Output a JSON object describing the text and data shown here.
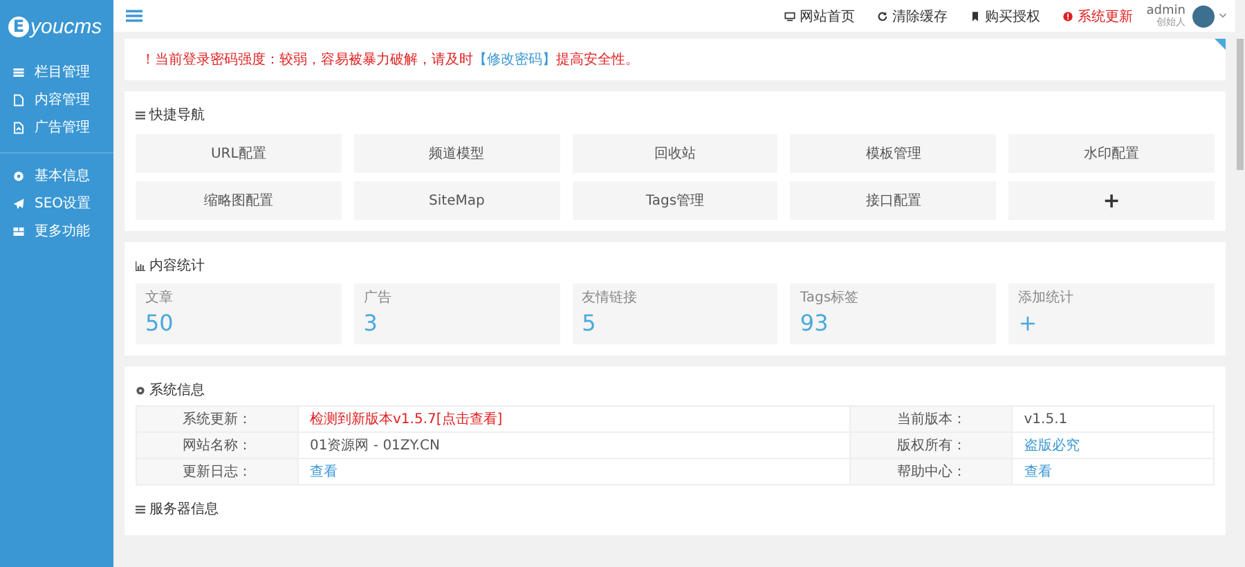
{
  "sidebar": {
    "logo_letter": "E",
    "logo_text": "youcms",
    "groups": [
      [
        {
          "label": "栏目管理"
        },
        {
          "label": "内容管理"
        },
        {
          "label": "广告管理"
        }
      ],
      [
        {
          "label": "基本信息"
        },
        {
          "label": "SEO设置"
        },
        {
          "label": "更多功能"
        }
      ]
    ]
  },
  "topbar": {
    "links": [
      {
        "label": "网站首页",
        "kind": "normal"
      },
      {
        "label": "清除缓存",
        "kind": "normal"
      },
      {
        "label": "购买授权",
        "kind": "normal"
      },
      {
        "label": "系统更新",
        "kind": "alert"
      }
    ],
    "user": {
      "name": "admin",
      "role": "创始人"
    }
  },
  "alert": {
    "before": "！当前登录密码强度：较弱，容易被暴力破解，请及时",
    "link": "【修改密码】",
    "after": "提高安全性。"
  },
  "quick_nav": {
    "title": "快捷导航",
    "items": [
      "URL配置",
      "频道模型",
      "回收站",
      "模板管理",
      "水印配置",
      "缩略图配置",
      "SiteMap",
      "Tags管理",
      "接口配置",
      "+"
    ]
  },
  "stats": {
    "title": "内容统计",
    "items": [
      {
        "label": "文章",
        "value": "50"
      },
      {
        "label": "广告",
        "value": "3"
      },
      {
        "label": "友情链接",
        "value": "5"
      },
      {
        "label": "Tags标签",
        "value": "93"
      },
      {
        "label": "添加统计",
        "value": "+"
      }
    ]
  },
  "system_info": {
    "title": "系统信息",
    "rows": [
      [
        {
          "text": "系统更新：",
          "kind": "label"
        },
        {
          "text": "检测到新版本v1.5.7[点击查看]",
          "kind": "alert"
        },
        {
          "text": "当前版本：",
          "kind": "label"
        },
        {
          "text": "v1.5.1",
          "kind": "value"
        }
      ],
      [
        {
          "text": "网站名称：",
          "kind": "label"
        },
        {
          "text": "01资源网 - 01ZY.CN",
          "kind": "value"
        },
        {
          "text": "版权所有：",
          "kind": "label"
        },
        {
          "text": "盗版必究",
          "kind": "link"
        }
      ],
      [
        {
          "text": "更新日志：",
          "kind": "label"
        },
        {
          "text": "查看",
          "kind": "link"
        },
        {
          "text": "帮助中心：",
          "kind": "label"
        },
        {
          "text": "查看",
          "kind": "link"
        }
      ]
    ]
  },
  "server_info": {
    "title": "服务器信息"
  }
}
